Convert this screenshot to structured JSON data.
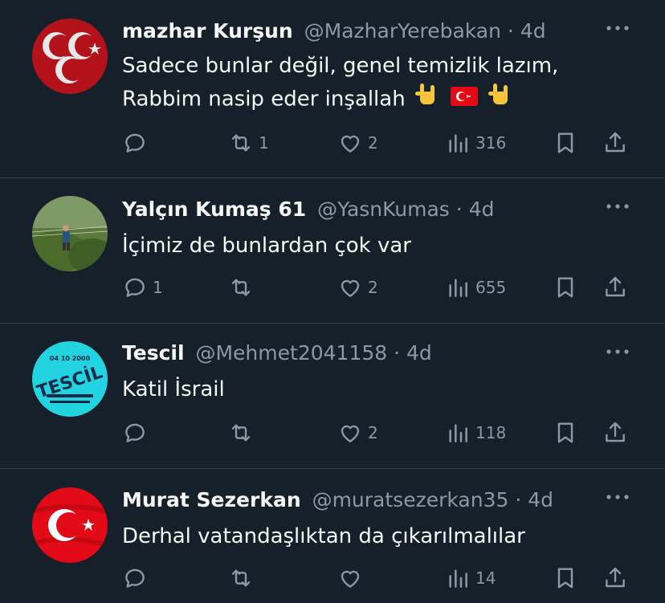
{
  "tweets": [
    {
      "name": "mazhar Kurşun",
      "handle": "@MazharYerebakan",
      "dot": "·",
      "time": "4d",
      "text": "Sadece bunlar değil, genel temizlik lazım, Rabbim nasip eder inşallah",
      "replies": "",
      "retweets": "1",
      "likes": "2",
      "views": "316"
    },
    {
      "name": "Yalçın Kumaş 61",
      "handle": "@YasnKumas",
      "dot": "·",
      "time": "4d",
      "text": "İçimiz de bunlardan çok var",
      "replies": "1",
      "retweets": "",
      "likes": "2",
      "views": "655"
    },
    {
      "name": "Tescil",
      "handle": "@Mehmet2041158",
      "dot": "·",
      "time": "4d",
      "text": "Katil İsrail",
      "replies": "",
      "retweets": "",
      "likes": "2",
      "views": "118"
    },
    {
      "name": "Murat Sezerkan",
      "handle": "@muratsezerkan35",
      "dot": "·",
      "time": "4d",
      "text": "Derhal vatandaşlıktan da çıkarılmalılar",
      "replies": "",
      "retweets": "",
      "likes": "",
      "views": "14"
    }
  ],
  "avatars": {
    "tescil_logo_text": "TESCİL",
    "tescil_date_text": "04 10 2000"
  },
  "colors": {
    "background": "#15202b",
    "divider": "#38444d",
    "text_primary": "#f7f9f9",
    "text_secondary": "#8b98a5",
    "flag_red": "#e30a17"
  }
}
